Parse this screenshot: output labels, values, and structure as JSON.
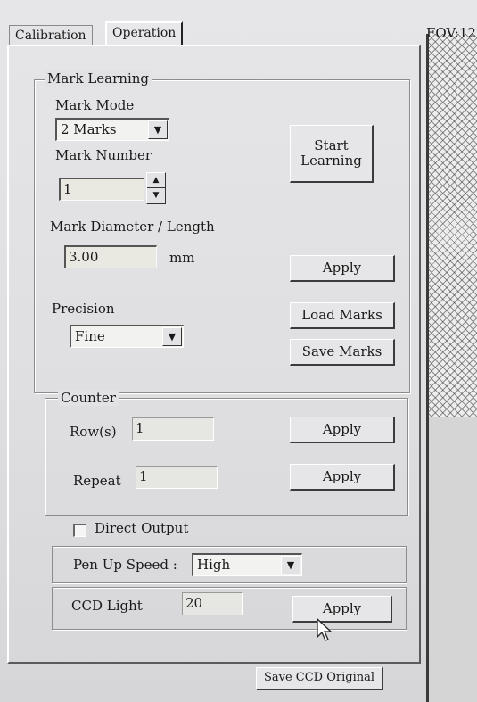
{
  "tabs": [
    {
      "label": "Calibration",
      "active": false
    },
    {
      "label": "Operation",
      "active": true
    }
  ],
  "fov_label": "FOV:12",
  "mark_learning": {
    "group_label": "Mark Learning",
    "mark_mode_label": "Mark Mode",
    "mark_mode_value": "2 Marks",
    "mark_number_label": "Mark Number",
    "mark_number_value": "1",
    "start_learning_line1": "Start",
    "start_learning_line2": "Learning",
    "diameter_label": "Mark Diameter / Length",
    "diameter_value": "3.00",
    "diameter_unit": "mm",
    "apply_label": "Apply",
    "precision_label": "Precision",
    "precision_value": "Fine",
    "load_marks_label": "Load Marks",
    "save_marks_label": "Save Marks"
  },
  "counter": {
    "group_label": "Counter",
    "rows_label": "Row(s)",
    "rows_value": "1",
    "rows_apply": "Apply",
    "repeat_label": "Repeat",
    "repeat_value": "1",
    "repeat_apply": "Apply"
  },
  "direct_output": {
    "label": "Direct Output",
    "checked": false
  },
  "pen_up_speed": {
    "label": "Pen Up Speed :",
    "value": "High"
  },
  "ccd_light": {
    "label": "CCD Light",
    "value": "20",
    "apply": "Apply"
  },
  "save_ccd_label": "Save CCD Original",
  "icons": {
    "dropdown": "chevron-down-icon",
    "spin_up": "up-arrow-icon",
    "spin_down": "down-arrow-icon",
    "cursor": "mouse-pointer-icon"
  }
}
